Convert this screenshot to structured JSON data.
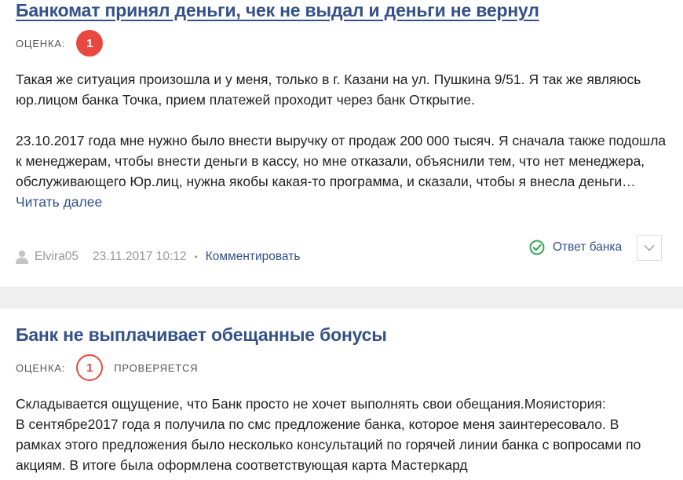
{
  "reviews": [
    {
      "title": "Банкомат принял деньги, чек не выдал и деньги не вернул",
      "rating_label": "ОЦЕНКА:",
      "rating_value": "1",
      "paragraphs": [
        "Такая же ситуация произошла и у меня, только в г. Казани на ул. Пушкина 9/51. Я так же являюсь юр.лицом банка Точка, прием платежей проходит через банк Открытие.",
        "23.10.2017 года мне нужно было внести выручку от продаж 200 000 тысяч. Я сначала также подошла к менеджерам, чтобы внести деньги в кассу, но мне отказали, объяснили тем, что нет менеджера, обслуживающего Юр.лиц, нужна якобы какая-то программа, и сказали, чтобы я внесла деньги…"
      ],
      "read_more": "Читать далее",
      "author": "Elvira05",
      "date": "23.11.2017 10:12",
      "separator": "•",
      "comment_label": "Комментировать",
      "bank_reply_label": "Ответ банка"
    },
    {
      "title": "Банк не выплачивает обещанные бонусы",
      "rating_label": "ОЦЕНКА:",
      "rating_value": "1",
      "status": "ПРОВЕРЯЕТСЯ",
      "paragraphs": [
        "Складывается ощущение, что Банк просто не хочет выполнять свои обещания.Мояистория:",
        "В сентябре2017 года я получила по смс предложение банка, которое меня заинтересовало. В рамках этого предложения было несколько консультаций по горячей линии банка с вопросами по акциям. В итоге была оформлена соответствующая карта Мастеркард"
      ]
    }
  ],
  "colors": {
    "link": "#34518a",
    "rating_badge": "#e8483f",
    "check_green": "#3aa655",
    "muted": "#999999"
  },
  "icons": {
    "author": "user-icon",
    "reply": "check-circle-icon",
    "dropdown": "chevron-down-icon"
  }
}
